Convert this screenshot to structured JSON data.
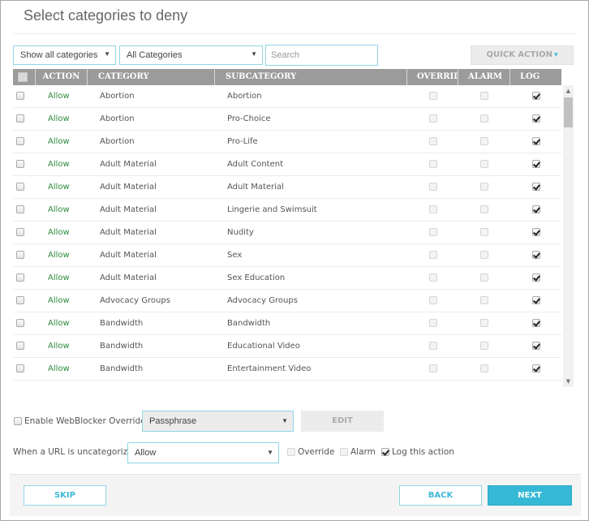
{
  "title": "Select categories to deny",
  "filters": {
    "show_select": "Show all categories",
    "category_select": "All Categories",
    "search_placeholder": "Search",
    "search_value": "",
    "quick_action_label": "QUICK ACTION"
  },
  "table": {
    "columns": [
      "ACTION",
      "CATEGORY",
      "SUBCATEGORY",
      "OVERRID",
      "ALARM",
      "LOG"
    ],
    "rows": [
      {
        "selected": false,
        "action": "Allow",
        "category": "Abortion",
        "subcategory": "Abortion",
        "override": false,
        "alarm": false,
        "log": true
      },
      {
        "selected": false,
        "action": "Allow",
        "category": "Abortion",
        "subcategory": "Pro-Choice",
        "override": false,
        "alarm": false,
        "log": true
      },
      {
        "selected": false,
        "action": "Allow",
        "category": "Abortion",
        "subcategory": "Pro-Life",
        "override": false,
        "alarm": false,
        "log": true
      },
      {
        "selected": false,
        "action": "Allow",
        "category": "Adult Material",
        "subcategory": "Adult Content",
        "override": false,
        "alarm": false,
        "log": true
      },
      {
        "selected": false,
        "action": "Allow",
        "category": "Adult Material",
        "subcategory": "Adult Material",
        "override": false,
        "alarm": false,
        "log": true
      },
      {
        "selected": false,
        "action": "Allow",
        "category": "Adult Material",
        "subcategory": "Lingerie and Swimsuit",
        "override": false,
        "alarm": false,
        "log": true
      },
      {
        "selected": false,
        "action": "Allow",
        "category": "Adult Material",
        "subcategory": "Nudity",
        "override": false,
        "alarm": false,
        "log": true
      },
      {
        "selected": false,
        "action": "Allow",
        "category": "Adult Material",
        "subcategory": "Sex",
        "override": false,
        "alarm": false,
        "log": true
      },
      {
        "selected": false,
        "action": "Allow",
        "category": "Adult Material",
        "subcategory": "Sex Education",
        "override": false,
        "alarm": false,
        "log": true
      },
      {
        "selected": false,
        "action": "Allow",
        "category": "Advocacy Groups",
        "subcategory": "Advocacy Groups",
        "override": false,
        "alarm": false,
        "log": true
      },
      {
        "selected": false,
        "action": "Allow",
        "category": "Bandwidth",
        "subcategory": "Bandwidth",
        "override": false,
        "alarm": false,
        "log": true
      },
      {
        "selected": false,
        "action": "Allow",
        "category": "Bandwidth",
        "subcategory": "Educational Video",
        "override": false,
        "alarm": false,
        "log": true
      },
      {
        "selected": false,
        "action": "Allow",
        "category": "Bandwidth",
        "subcategory": "Entertainment Video",
        "override": false,
        "alarm": false,
        "log": true
      }
    ]
  },
  "override": {
    "enable_label": "Enable WebBlocker Override",
    "enabled": false,
    "method_select": "Passphrase",
    "edit_label": "EDIT"
  },
  "uncategorized": {
    "label": "When a URL is uncategorized",
    "action_select": "Allow",
    "override_label": "Override",
    "override_checked": false,
    "alarm_label": "Alarm",
    "alarm_checked": false,
    "log_label": "Log this action",
    "log_checked": true
  },
  "footer": {
    "skip_label": "SKIP",
    "back_label": "BACK",
    "next_label": "NEXT"
  },
  "colors": {
    "accent": "#35b9d5",
    "allow_text": "#2e8b3e",
    "header_bg": "#9b9b9b"
  }
}
